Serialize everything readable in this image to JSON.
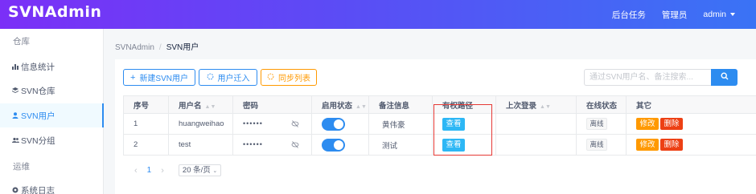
{
  "header": {
    "logo": "SVNAdmin",
    "tasks": "后台任务",
    "role": "管理员",
    "user": "admin"
  },
  "sidebar": {
    "group1": "仓库",
    "items": [
      {
        "label": "信息统计",
        "icon": "bar-chart-icon"
      },
      {
        "label": "SVN仓库",
        "icon": "layers-icon"
      },
      {
        "label": "SVN用户",
        "icon": "person-icon",
        "active": true
      },
      {
        "label": "SVN分组",
        "icon": "people-icon"
      }
    ],
    "group2": "运维",
    "items2": [
      {
        "label": "系统日志",
        "icon": "log-icon"
      }
    ]
  },
  "breadcrumb": {
    "root": "SVNAdmin",
    "sep": "/",
    "current": "SVN用户"
  },
  "toolbar": {
    "new_user": "新建SVN用户",
    "migrate": "用户迁入",
    "sync": "同步列表",
    "search_placeholder": "通过SVN用户名、备注搜索..."
  },
  "table": {
    "headers": [
      "序号",
      "用户名",
      "密码",
      "启用状态",
      "备注信息",
      "有权路径",
      "上次登录",
      "在线状态",
      "其它"
    ],
    "rows": [
      {
        "index": "1",
        "username": "huangweihao",
        "password": "••••••",
        "enabled": true,
        "note": "黄伟豪",
        "path_btn": "查看",
        "last_login": "",
        "online": "离线",
        "edit": "修改",
        "delete": "删除"
      },
      {
        "index": "2",
        "username": "test",
        "password": "••••••",
        "enabled": true,
        "note": "测试",
        "path_btn": "查看",
        "last_login": "",
        "online": "离线",
        "edit": "修改",
        "delete": "删除"
      }
    ]
  },
  "pager": {
    "prev": "‹",
    "page": "1",
    "next": "›",
    "size": "20 条/页"
  },
  "colors": {
    "primary": "#2d8cf0",
    "warning": "#ff9900",
    "danger": "#ed4014",
    "info": "#2db7f5",
    "highlight": "#e53935"
  }
}
